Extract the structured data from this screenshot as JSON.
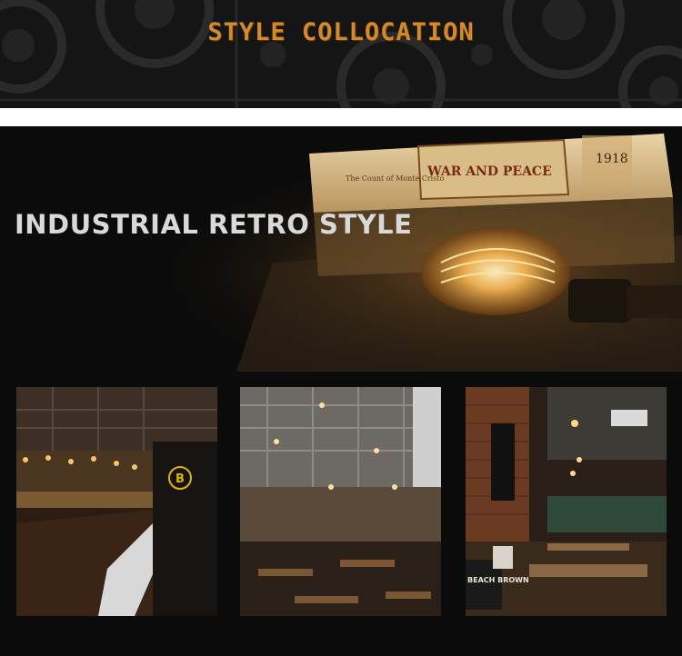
{
  "banner": {
    "title": "STYLE COLLOCATION"
  },
  "hero": {
    "title": "INDUSTRIAL RETRO STYLE",
    "book": {
      "spine_title": "WAR AND PEACE",
      "spine_subtitle": "The Count of Monte Cristo",
      "spine_year": "1918"
    }
  },
  "photos": [
    {
      "name": "bar-counter-photo",
      "sign_letter": "B"
    },
    {
      "name": "dining-hall-photo"
    },
    {
      "name": "brick-restaurant-photo",
      "pillow_text": "BEACH BROWN"
    }
  ],
  "colors": {
    "accent": "#d38a2a",
    "title_grey": "#d9d9d9",
    "background_dark": "#0b0b0b"
  }
}
